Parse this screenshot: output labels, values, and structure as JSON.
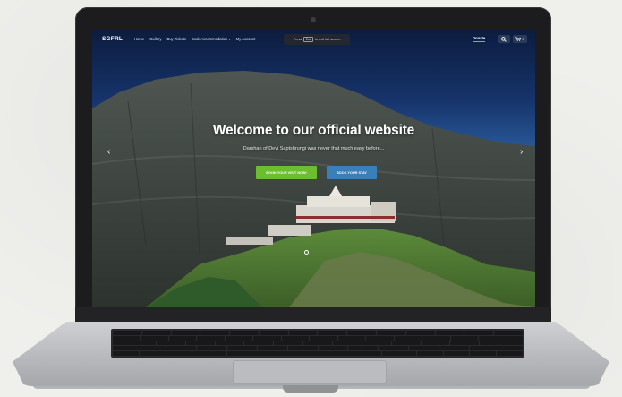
{
  "nav": {
    "brand": "SGFRL",
    "links": [
      "Home",
      "Gallery",
      "Buy Tickets",
      "Book Accommodation",
      "My Account"
    ],
    "dropdown_caret": "▾",
    "esc_hint_prefix": "Press",
    "esc_key": "Esc",
    "esc_hint_suffix": "to exit full screen",
    "donate": "Donate",
    "cart_count": "0"
  },
  "hero": {
    "title": "Welcome to our official website",
    "subtitle": "Darshan of Devi Saptshrungi was never that much easy before...",
    "btn_visit": "BOOK YOUR VISIT NOW!",
    "btn_stay": "BOOK YOUR STAY",
    "prev_arrow": "‹",
    "next_arrow": "›"
  },
  "colors": {
    "accent_green": "#6bbf2e",
    "accent_blue": "#3a7fb8",
    "nav_bg": "#0b1a3a"
  },
  "icons": [
    "search-icon",
    "cart-icon",
    "chevron-left-icon",
    "chevron-right-icon",
    "camera-icon"
  ]
}
